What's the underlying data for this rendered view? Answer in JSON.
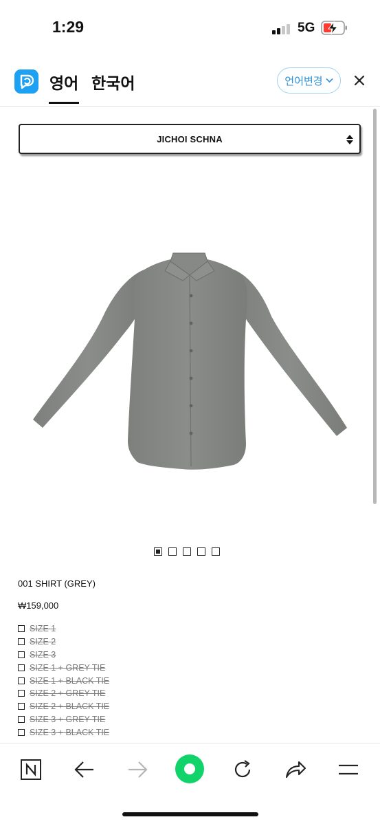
{
  "status_bar": {
    "time": "1:29",
    "network": "5G"
  },
  "translator": {
    "source_lang": "영어",
    "target_lang": "한국어",
    "change_button": "언어변경",
    "accent": "#1ea0f3"
  },
  "brand_select": {
    "value": "JICHOI SCHNA"
  },
  "product": {
    "image_alt": "grey-shirt",
    "pager_count": 5,
    "pager_active": 1,
    "name": "001 SHIRT (GREY)",
    "price": "₩159,000",
    "options": [
      {
        "label": "SIZE 1"
      },
      {
        "label": "SIZE 2"
      },
      {
        "label": "SIZE 3"
      },
      {
        "label": "SIZE 1 + GREY TIE"
      },
      {
        "label": "SIZE 1 + BLACK TIE"
      },
      {
        "label": "SIZE 2 + GREY TIE"
      },
      {
        "label": "SIZE 2 + BLACK TIE"
      },
      {
        "label": "SIZE 3 + GREY TIE"
      },
      {
        "label": "SIZE 3 + BLACK TIE"
      }
    ]
  },
  "toolbar": {
    "items": [
      "naver-icon",
      "back-arrow-icon",
      "forward-arrow-icon",
      "green-dot-icon",
      "refresh-icon",
      "share-icon",
      "menu-icon"
    ],
    "green": "#10d36a"
  }
}
